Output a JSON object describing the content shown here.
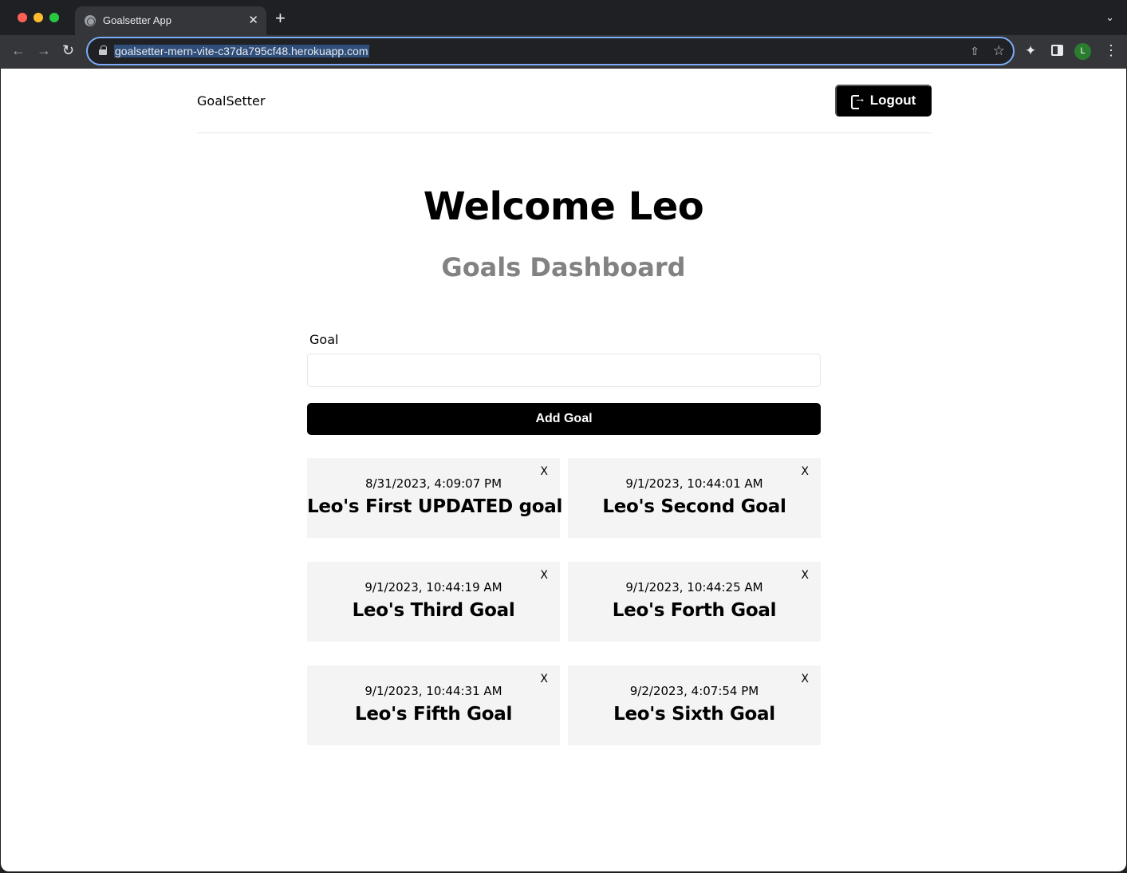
{
  "browser": {
    "tab_title": "Goalsetter App",
    "tab_close": "✕",
    "new_tab": "+",
    "tab_menu": "⌄",
    "url": "goalsetter-mern-vite-c37da795cf48.herokuapp.com",
    "profile_initial": "L"
  },
  "header": {
    "brand": "GoalSetter",
    "logout_label": "Logout"
  },
  "main": {
    "welcome": "Welcome Leo",
    "subtitle": "Goals Dashboard"
  },
  "form": {
    "goal_label": "Goal",
    "goal_value": "",
    "add_button_label": "Add Goal"
  },
  "goals": [
    {
      "date": "8/31/2023, 4:09:07 PM",
      "text": "Leo's First UPDATED goal",
      "close": "X"
    },
    {
      "date": "9/1/2023, 10:44:01 AM",
      "text": "Leo's Second Goal",
      "close": "X"
    },
    {
      "date": "9/1/2023, 10:44:19 AM",
      "text": "Leo's Third Goal",
      "close": "X"
    },
    {
      "date": "9/1/2023, 10:44:25 AM",
      "text": "Leo's Forth Goal",
      "close": "X"
    },
    {
      "date": "9/1/2023, 10:44:31 AM",
      "text": "Leo's Fifth Goal",
      "close": "X"
    },
    {
      "date": "9/2/2023, 4:07:54 PM",
      "text": "Leo's Sixth Goal",
      "close": "X"
    }
  ],
  "colors": {
    "accent": "#000000",
    "subtitle": "#828282",
    "card_bg": "#f4f4f4"
  }
}
